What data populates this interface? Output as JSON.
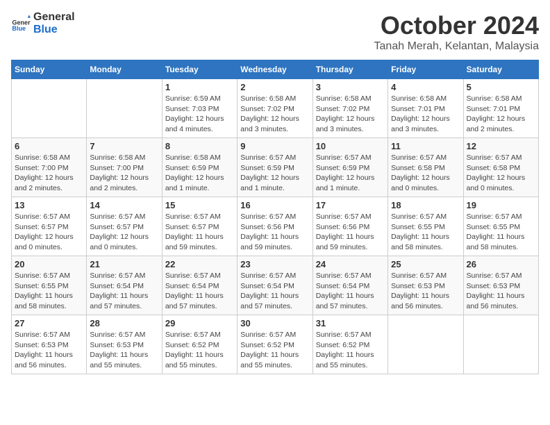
{
  "header": {
    "logo_general": "General",
    "logo_blue": "Blue",
    "month": "October 2024",
    "location": "Tanah Merah, Kelantan, Malaysia"
  },
  "weekdays": [
    "Sunday",
    "Monday",
    "Tuesday",
    "Wednesday",
    "Thursday",
    "Friday",
    "Saturday"
  ],
  "weeks": [
    [
      {
        "day": "",
        "info": ""
      },
      {
        "day": "",
        "info": ""
      },
      {
        "day": "1",
        "info": "Sunrise: 6:59 AM\nSunset: 7:03 PM\nDaylight: 12 hours\nand 4 minutes."
      },
      {
        "day": "2",
        "info": "Sunrise: 6:58 AM\nSunset: 7:02 PM\nDaylight: 12 hours\nand 3 minutes."
      },
      {
        "day": "3",
        "info": "Sunrise: 6:58 AM\nSunset: 7:02 PM\nDaylight: 12 hours\nand 3 minutes."
      },
      {
        "day": "4",
        "info": "Sunrise: 6:58 AM\nSunset: 7:01 PM\nDaylight: 12 hours\nand 3 minutes."
      },
      {
        "day": "5",
        "info": "Sunrise: 6:58 AM\nSunset: 7:01 PM\nDaylight: 12 hours\nand 2 minutes."
      }
    ],
    [
      {
        "day": "6",
        "info": "Sunrise: 6:58 AM\nSunset: 7:00 PM\nDaylight: 12 hours\nand 2 minutes."
      },
      {
        "day": "7",
        "info": "Sunrise: 6:58 AM\nSunset: 7:00 PM\nDaylight: 12 hours\nand 2 minutes."
      },
      {
        "day": "8",
        "info": "Sunrise: 6:58 AM\nSunset: 6:59 PM\nDaylight: 12 hours\nand 1 minute."
      },
      {
        "day": "9",
        "info": "Sunrise: 6:57 AM\nSunset: 6:59 PM\nDaylight: 12 hours\nand 1 minute."
      },
      {
        "day": "10",
        "info": "Sunrise: 6:57 AM\nSunset: 6:59 PM\nDaylight: 12 hours\nand 1 minute."
      },
      {
        "day": "11",
        "info": "Sunrise: 6:57 AM\nSunset: 6:58 PM\nDaylight: 12 hours\nand 0 minutes."
      },
      {
        "day": "12",
        "info": "Sunrise: 6:57 AM\nSunset: 6:58 PM\nDaylight: 12 hours\nand 0 minutes."
      }
    ],
    [
      {
        "day": "13",
        "info": "Sunrise: 6:57 AM\nSunset: 6:57 PM\nDaylight: 12 hours\nand 0 minutes."
      },
      {
        "day": "14",
        "info": "Sunrise: 6:57 AM\nSunset: 6:57 PM\nDaylight: 12 hours\nand 0 minutes."
      },
      {
        "day": "15",
        "info": "Sunrise: 6:57 AM\nSunset: 6:57 PM\nDaylight: 11 hours\nand 59 minutes."
      },
      {
        "day": "16",
        "info": "Sunrise: 6:57 AM\nSunset: 6:56 PM\nDaylight: 11 hours\nand 59 minutes."
      },
      {
        "day": "17",
        "info": "Sunrise: 6:57 AM\nSunset: 6:56 PM\nDaylight: 11 hours\nand 59 minutes."
      },
      {
        "day": "18",
        "info": "Sunrise: 6:57 AM\nSunset: 6:55 PM\nDaylight: 11 hours\nand 58 minutes."
      },
      {
        "day": "19",
        "info": "Sunrise: 6:57 AM\nSunset: 6:55 PM\nDaylight: 11 hours\nand 58 minutes."
      }
    ],
    [
      {
        "day": "20",
        "info": "Sunrise: 6:57 AM\nSunset: 6:55 PM\nDaylight: 11 hours\nand 58 minutes."
      },
      {
        "day": "21",
        "info": "Sunrise: 6:57 AM\nSunset: 6:54 PM\nDaylight: 11 hours\nand 57 minutes."
      },
      {
        "day": "22",
        "info": "Sunrise: 6:57 AM\nSunset: 6:54 PM\nDaylight: 11 hours\nand 57 minutes."
      },
      {
        "day": "23",
        "info": "Sunrise: 6:57 AM\nSunset: 6:54 PM\nDaylight: 11 hours\nand 57 minutes."
      },
      {
        "day": "24",
        "info": "Sunrise: 6:57 AM\nSunset: 6:54 PM\nDaylight: 11 hours\nand 57 minutes."
      },
      {
        "day": "25",
        "info": "Sunrise: 6:57 AM\nSunset: 6:53 PM\nDaylight: 11 hours\nand 56 minutes."
      },
      {
        "day": "26",
        "info": "Sunrise: 6:57 AM\nSunset: 6:53 PM\nDaylight: 11 hours\nand 56 minutes."
      }
    ],
    [
      {
        "day": "27",
        "info": "Sunrise: 6:57 AM\nSunset: 6:53 PM\nDaylight: 11 hours\nand 56 minutes."
      },
      {
        "day": "28",
        "info": "Sunrise: 6:57 AM\nSunset: 6:53 PM\nDaylight: 11 hours\nand 55 minutes."
      },
      {
        "day": "29",
        "info": "Sunrise: 6:57 AM\nSunset: 6:52 PM\nDaylight: 11 hours\nand 55 minutes."
      },
      {
        "day": "30",
        "info": "Sunrise: 6:57 AM\nSunset: 6:52 PM\nDaylight: 11 hours\nand 55 minutes."
      },
      {
        "day": "31",
        "info": "Sunrise: 6:57 AM\nSunset: 6:52 PM\nDaylight: 11 hours\nand 55 minutes."
      },
      {
        "day": "",
        "info": ""
      },
      {
        "day": "",
        "info": ""
      }
    ]
  ]
}
